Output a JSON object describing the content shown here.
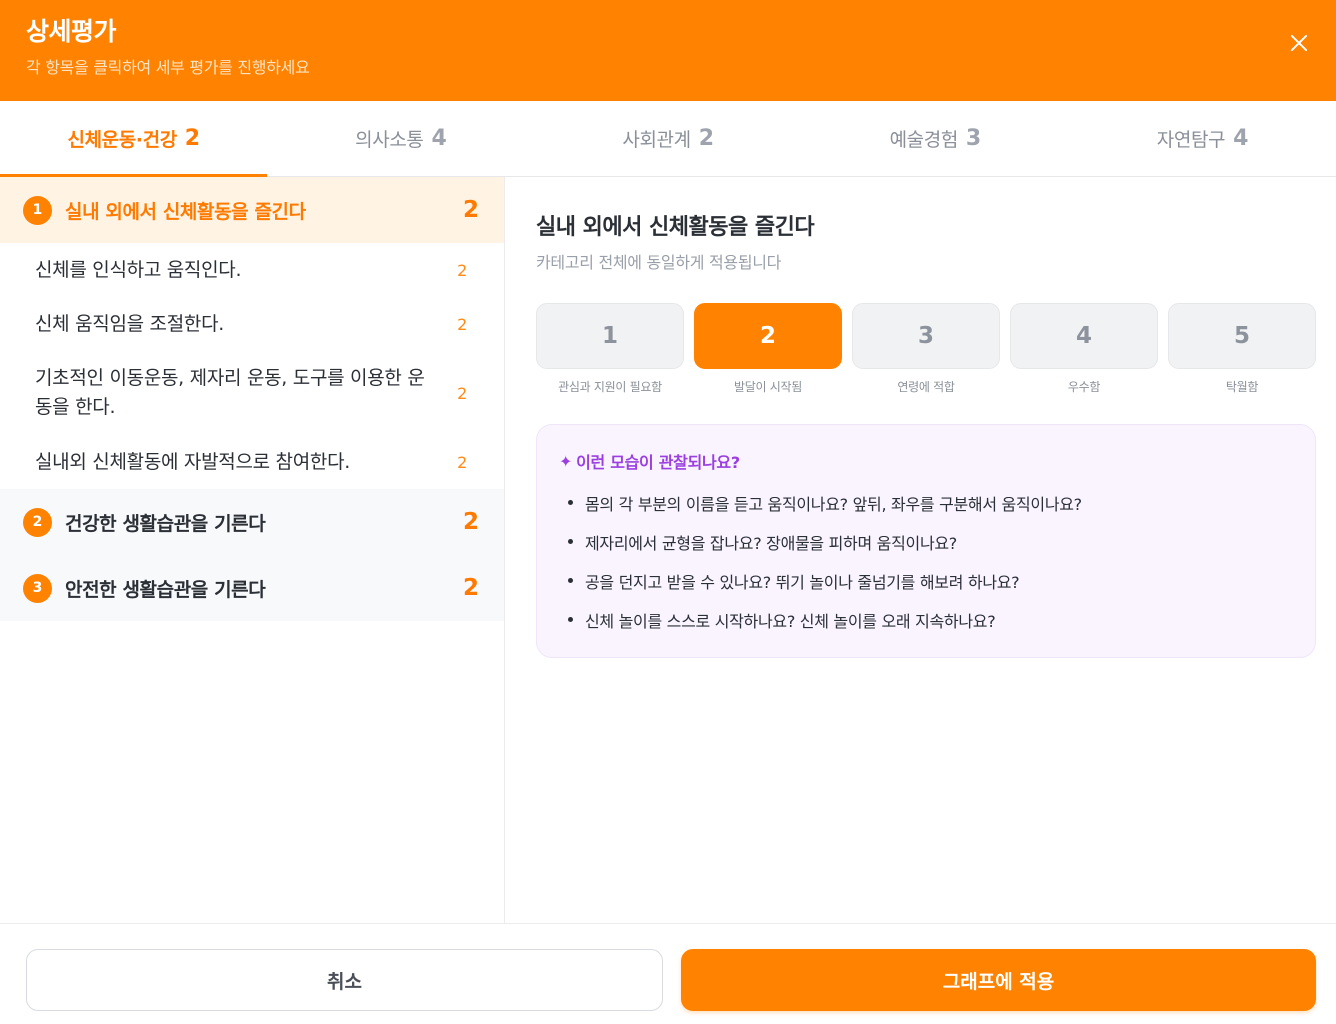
{
  "header": {
    "title": "상세평가",
    "subtitle": "각 항목을 클릭하여 세부 평가를 진행하세요"
  },
  "tabs": [
    {
      "label": "신체운동·건강",
      "score": "2",
      "active": true
    },
    {
      "label": "의사소통",
      "score": "4",
      "active": false
    },
    {
      "label": "사회관계",
      "score": "2",
      "active": false
    },
    {
      "label": "예술경험",
      "score": "3",
      "active": false
    },
    {
      "label": "자연탐구",
      "score": "4",
      "active": false
    }
  ],
  "groups": [
    {
      "number": "1",
      "label": "실내 외에서 신체활동을 즐긴다",
      "score": "2",
      "items": [
        {
          "label": "신체를 인식하고 움직인다.",
          "score": "2"
        },
        {
          "label": "신체 움직임을 조절한다.",
          "score": "2"
        },
        {
          "label": "기초적인 이동운동, 제자리 운동, 도구를 이용한 운동을 한다.",
          "score": "2"
        },
        {
          "label": "실내외 신체활동에 자발적으로 참여한다.",
          "score": "2"
        }
      ]
    },
    {
      "number": "2",
      "label": "건강한 생활습관을 기른다",
      "score": "2"
    },
    {
      "number": "3",
      "label": "안전한 생활습관을 기른다",
      "score": "2"
    }
  ],
  "detail": {
    "title": "실내 외에서 신체활동을 즐긴다",
    "subtitle": "카테고리 전체에 동일하게 적용됩니다",
    "selected_score": 2,
    "scores": [
      {
        "value": "1",
        "caption": "관심과 지원이 필요함"
      },
      {
        "value": "2",
        "caption": "발달이 시작됨"
      },
      {
        "value": "3",
        "caption": "연령에 적합"
      },
      {
        "value": "4",
        "caption": "우수함"
      },
      {
        "value": "5",
        "caption": "탁월함"
      }
    ],
    "observation": {
      "icon": "sparkle-icon",
      "heading": "이런 모습이 관찰되나요?",
      "questions": [
        "몸의 각 부분의 이름을 듣고 움직이나요? 앞뒤, 좌우를 구분해서 움직이나요?",
        "제자리에서 균형을 잡나요? 장애물을 피하며 움직이나요?",
        "공을 던지고 받을 수 있나요? 뛰기 놀이나 줄넘기를 해보려 하나요?",
        "신체 놀이를 스스로 시작하나요? 신체 놀이를 오래 지속하나요?"
      ]
    }
  },
  "footer": {
    "cancel_label": "취소",
    "apply_label": "그래프에 적용"
  },
  "colors": {
    "accent": "#ff8200",
    "active_row": "#fff3e4",
    "observation_bg": "#f9f4ff",
    "observation_heading": "#9b3fe0"
  }
}
